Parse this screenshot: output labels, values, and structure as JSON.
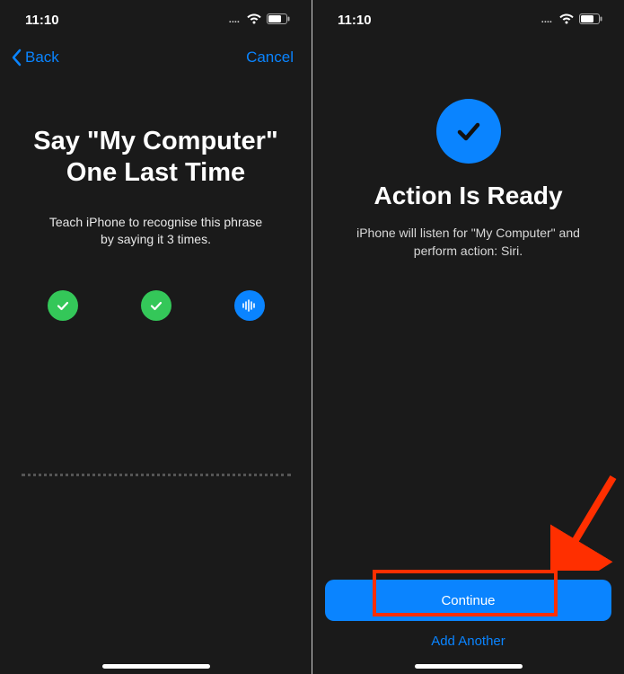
{
  "colors": {
    "ios_blue": "#0A84FF",
    "ios_green": "#34C759",
    "highlight_red": "#ff2f00"
  },
  "status": {
    "time": "11:10",
    "signal_dots": "....",
    "wifi_icon": "wifi",
    "battery_icon": "battery"
  },
  "screen1": {
    "nav": {
      "back_label": "Back",
      "cancel_label": "Cancel"
    },
    "title_line1": "Say \"My Computer\"",
    "title_line2": "One Last Time",
    "subtitle_line1": "Teach iPhone to recognise this phrase",
    "subtitle_line2": "by saying it 3 times.",
    "progress": [
      {
        "state": "done"
      },
      {
        "state": "done"
      },
      {
        "state": "recording"
      }
    ]
  },
  "screen2": {
    "title": "Action Is Ready",
    "subtitle_line1": "iPhone will listen for \"My Computer\" and",
    "subtitle_line2": "perform action: Siri.",
    "buttons": {
      "continue_label": "Continue",
      "add_another_label": "Add Another"
    }
  }
}
